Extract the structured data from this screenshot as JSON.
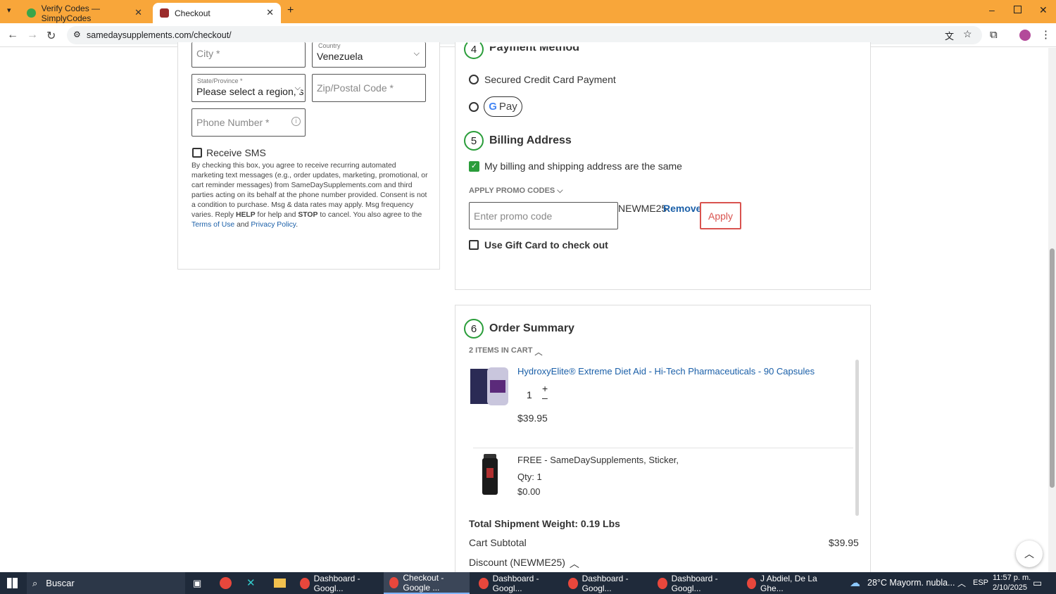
{
  "browser": {
    "tabs": [
      {
        "title": "Verify Codes — SimplyCodes"
      },
      {
        "title": "Checkout"
      }
    ],
    "url": "samedaysupplements.com/checkout/"
  },
  "shipping_form": {
    "city_placeholder": "City *",
    "country_label": "Country",
    "country_value": "Venezuela",
    "state_label": "State/Province *",
    "state_value": "Please select a region, s",
    "zip_placeholder": "Zip/Postal Code *",
    "phone_placeholder": "Phone Number *",
    "receive_sms_label": "Receive SMS",
    "sms_disclaimer_1": "By checking this box, you agree to receive recurring automated marketing text messages (e.g., order updates, marketing, promotional, or cart reminder messages) from SameDaySupplements.com and third parties acting on its behalf at the phone number provided. Consent is not a condition to purchase. Msg & data rates may apply. Msg frequency varies. Reply ",
    "sms_help": "HELP",
    "sms_mid": " for help and ",
    "sms_stop": "STOP",
    "sms_cancel": " to cancel. You also agree to the ",
    "terms_link": "Terms of Use",
    "sms_and": " and ",
    "privacy_link": "Privacy Policy",
    "sms_end": "."
  },
  "payment": {
    "step": "4",
    "title": "Payment Method",
    "option_card": "Secured Credit Card Payment",
    "option_gpay": "Pay"
  },
  "billing": {
    "step": "5",
    "title": "Billing Address",
    "same_address_label": "My billing and shipping address are the same",
    "promo_header": "APPLY PROMO CODES",
    "promo_placeholder": "Enter promo code",
    "applied_code": "NEWME25",
    "remove_label": "Remove",
    "apply_label": "Apply",
    "gift_card_label": "Use Gift Card to check out"
  },
  "summary": {
    "step": "6",
    "title": "Order Summary",
    "items_in_cart": "2 ITEMS IN CART",
    "items": [
      {
        "name": "HydroxyElite® Extreme Diet Aid - Hi-Tech Pharmaceuticals - 90 Capsules",
        "qty": "1",
        "price": "$39.95"
      },
      {
        "name": "FREE - SameDaySupplements, Sticker,",
        "qty": "Qty: 1",
        "price": "$0.00"
      }
    ],
    "shipment_weight": "Total Shipment Weight: 0.19 Lbs",
    "subtotal_label": "Cart Subtotal",
    "subtotal_value": "$39.95",
    "discount_label": "Discount (NEWME25)"
  },
  "taskbar": {
    "search_placeholder": "Buscar",
    "apps": [
      "Dashboard - Googl...",
      "Checkout - Google ...",
      "Dashboard - Googl...",
      "Dashboard - Googl...",
      "Dashboard - Googl...",
      "J Abdiel, De La Ghe..."
    ],
    "weather": "28°C  Mayorm. nubla...",
    "lang": "ESP",
    "time": "11:57 p. m.",
    "date": "2/10/2025"
  },
  "colors": {
    "tabbar": "#f8a63a",
    "accent_green": "#2a9d3a",
    "link_blue": "#1a5fa8",
    "apply_red": "#d9534f"
  }
}
